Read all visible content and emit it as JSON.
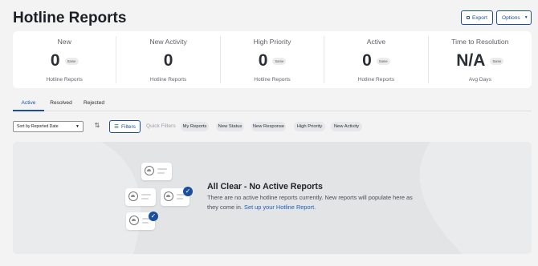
{
  "page": {
    "title": "Hotline Reports"
  },
  "header": {
    "export_label": "Export",
    "options_label": "Options"
  },
  "stats": [
    {
      "label": "New",
      "value": "0",
      "badge": "Same",
      "sub": "Hotline Reports"
    },
    {
      "label": "New Activity",
      "value": "0",
      "badge": "",
      "sub": "Hotline Reports"
    },
    {
      "label": "High Priority",
      "value": "0",
      "badge": "Same",
      "sub": "Hotline Reports"
    },
    {
      "label": "Active",
      "value": "0",
      "badge": "Same",
      "sub": "Hotline Reports"
    },
    {
      "label": "Time to Resolution",
      "value": "N/A",
      "badge": "Same",
      "sub": "Avg Days"
    }
  ],
  "tabs": [
    {
      "label": "Active",
      "active": true
    },
    {
      "label": "Resolved",
      "active": false
    },
    {
      "label": "Rejected",
      "active": false
    }
  ],
  "toolbar": {
    "sort_value": "Sort by Reported Date",
    "filters_label": "Filters",
    "quick_filters_label": "Quick Filters",
    "chips": [
      "My Reports",
      "New Status",
      "New Response",
      "High Priority",
      "New Activity"
    ]
  },
  "empty_state": {
    "title": "All Clear - No Active Reports",
    "description": "There are no active hotline reports currently. New reports will populate here as they come in.",
    "link": "Set up your Hotline Report."
  },
  "icons": {
    "export": "export-icon",
    "options_caret": "chevron-down-icon",
    "sort_toggle": "sort-direction-icon",
    "filters": "filter-icon",
    "check": "checkmark-icon",
    "avatar": "user-avatar-icon"
  },
  "colors": {
    "accent": "#1b4f9c",
    "link": "#1b5fb8",
    "empty_bg": "#e3e4e6"
  }
}
